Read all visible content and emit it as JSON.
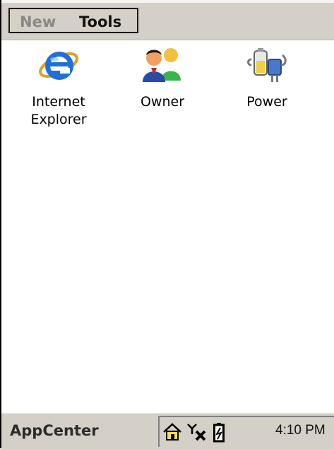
{
  "menubar": {
    "items": [
      "New",
      "Tools"
    ]
  },
  "apps": [
    {
      "label_lines": [
        "Internet",
        "Explorer"
      ],
      "icon": "internet-explorer-icon"
    },
    {
      "label_lines": [
        "Owner"
      ],
      "icon": "owner-icon"
    },
    {
      "label_lines": [
        "Power"
      ],
      "icon": "power-icon"
    }
  ],
  "taskbar": {
    "title": "AppCenter",
    "clock": "4:10 PM",
    "tray_icons": [
      "home-icon",
      "signal-off-icon",
      "battery-icon"
    ]
  },
  "colors": {
    "chrome": "#d4d0c8",
    "background": "#ffffff",
    "ie_blue": "#1e6fd8"
  }
}
